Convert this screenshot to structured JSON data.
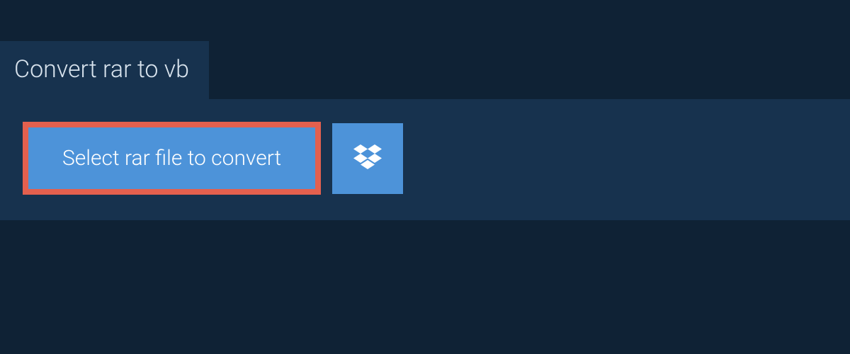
{
  "tab": {
    "title": "Convert rar to vb"
  },
  "actions": {
    "select_label": "Select rar file to convert"
  },
  "colors": {
    "background": "#0f2235",
    "panel": "#17324e",
    "button": "#4d93d9",
    "highlight_border": "#e4604e",
    "text_light": "#d8e3ed"
  }
}
